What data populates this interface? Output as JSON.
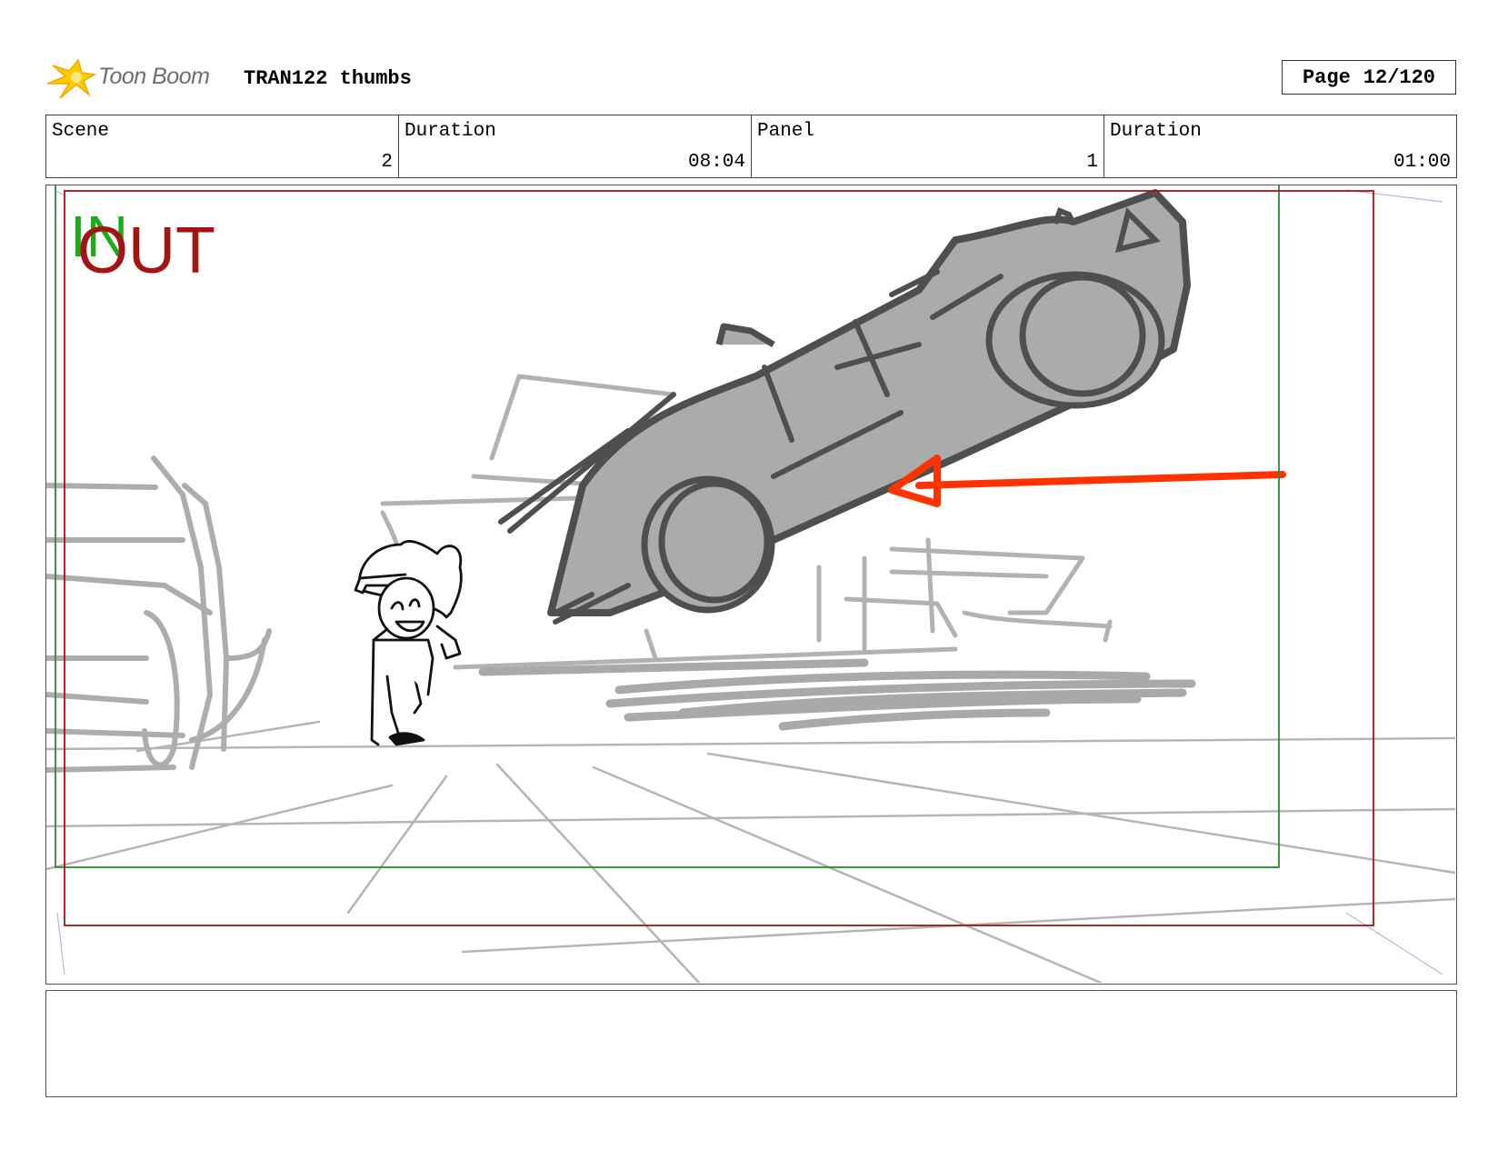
{
  "header": {
    "logo_text": "Toon Boom",
    "title": "TRAN122 thumbs",
    "page_label": "Page",
    "page_value": "12/120"
  },
  "info": {
    "scene_label": "Scene",
    "scene_value": "2",
    "scene_duration_label": "Duration",
    "scene_duration_value": "08:04",
    "panel_label": "Panel",
    "panel_value": "1",
    "panel_duration_label": "Duration",
    "panel_duration_value": "01:00"
  },
  "panel": {
    "in_label": "IN",
    "out_label": "OUT",
    "colors": {
      "in_frame": "#2e8b2e",
      "out_frame": "#a31515",
      "in_text": "#1aad1a",
      "out_text": "#a31515",
      "arrow": "#ff3300",
      "car_fill": "#ababab",
      "car_outline": "#4f4f4f",
      "sketch": "#aaaaaa"
    }
  },
  "notes": {
    "text": ""
  }
}
